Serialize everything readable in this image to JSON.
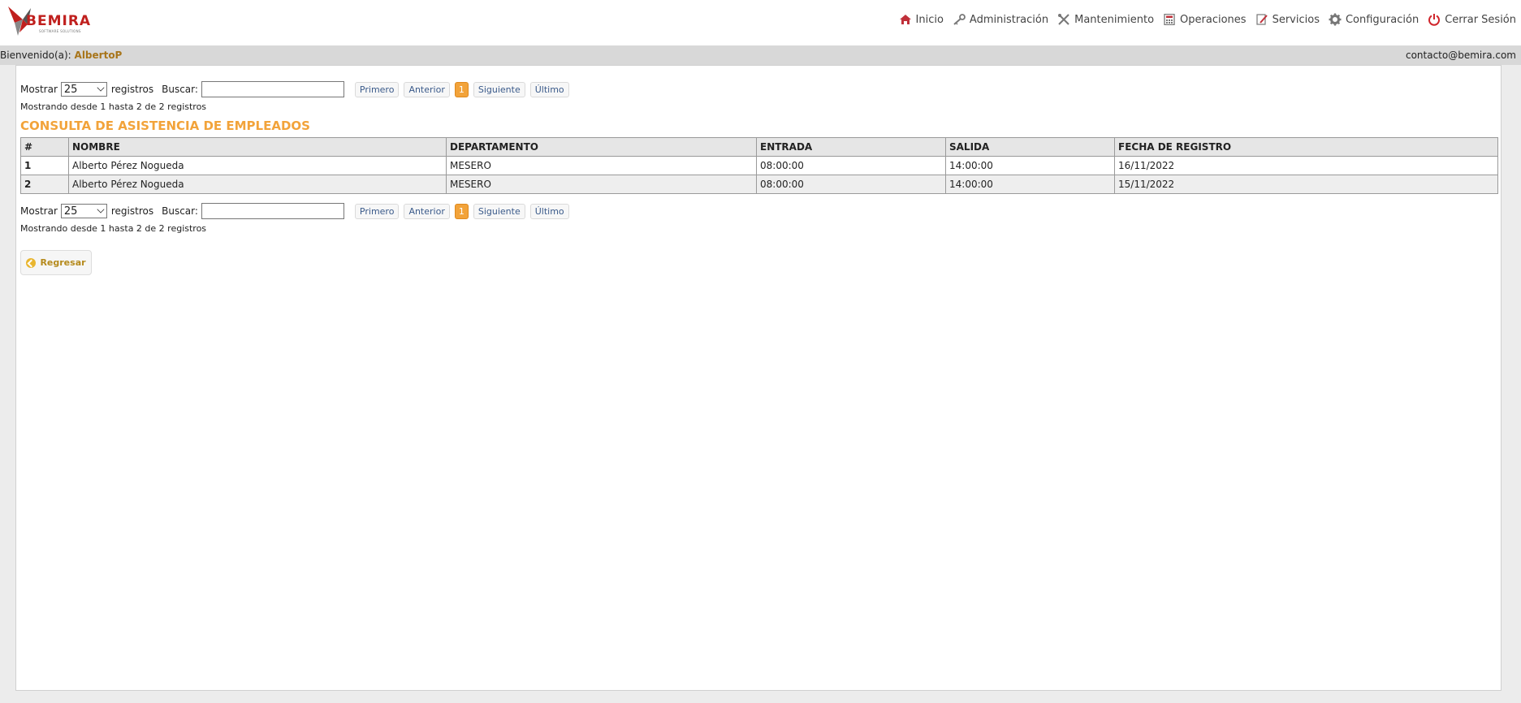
{
  "brand": {
    "name": "BEMIRA",
    "tagline": "SOFTWARE SOLUTIONS",
    "color": "#c0201e"
  },
  "nav": [
    {
      "icon": "home-icon",
      "label": "Inicio"
    },
    {
      "icon": "key-icon",
      "label": "Administración"
    },
    {
      "icon": "tools-icon",
      "label": "Mantenimiento"
    },
    {
      "icon": "calculator-icon",
      "label": "Operaciones"
    },
    {
      "icon": "pencil-icon",
      "label": "Servicios"
    },
    {
      "icon": "gear-icon",
      "label": "Configuración"
    },
    {
      "icon": "power-icon",
      "label": "Cerrar Sesión"
    }
  ],
  "welcome": {
    "prefix": "Bienvenido(a):",
    "user": "AlbertoP",
    "contact": "contacto@bemira.com"
  },
  "controls": {
    "show_label": "Mostrar",
    "show_value": "25",
    "records_label": "registros",
    "search_label": "Buscar:",
    "search_value": "",
    "pager": {
      "first": "Primero",
      "prev": "Anterior",
      "page": "1",
      "next": "Siguiente",
      "last": "Último"
    },
    "info": "Mostrando desde 1 hasta 2 de 2 registros"
  },
  "title": "CONSULTA DE ASISTENCIA DE EMPLEADOS",
  "table": {
    "headers": [
      "#",
      "NOMBRE",
      "DEPARTAMENTO",
      "ENTRADA",
      "SALIDA",
      "FECHA DE REGISTRO"
    ],
    "rows": [
      [
        "1",
        "Alberto Pérez Nogueda",
        "MESERO",
        "08:00:00",
        "14:00:00",
        "16/11/2022"
      ],
      [
        "2",
        "Alberto Pérez Nogueda",
        "MESERO",
        "08:00:00",
        "14:00:00",
        "15/11/2022"
      ]
    ]
  },
  "back_button": "Regresar",
  "colors": {
    "accent": "#f2a33a",
    "brand_red": "#c0201e",
    "user_gold": "#a8751a"
  }
}
